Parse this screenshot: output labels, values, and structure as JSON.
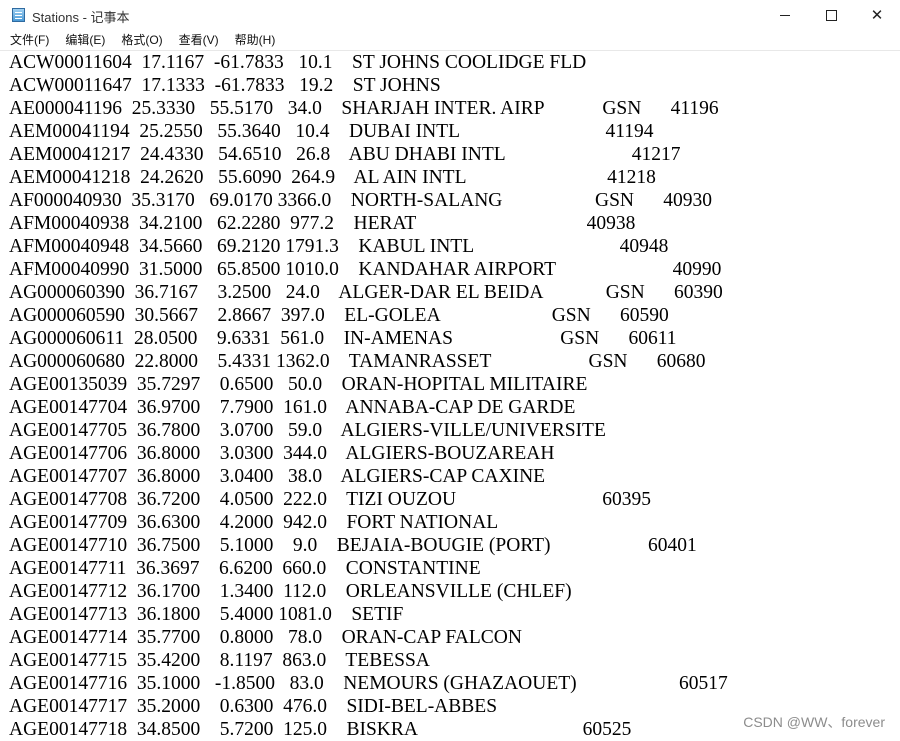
{
  "window": {
    "title": "Stations - 记事本",
    "icon": "notepad-icon"
  },
  "menu": [
    "文件(F)",
    "编辑(E)",
    "格式(O)",
    "查看(V)",
    "帮助(H)"
  ],
  "lines": [
    "ACW00011604  17.1167  -61.7833   10.1    ST JOHNS COOLIDGE FLD",
    "ACW00011647  17.1333  -61.7833   19.2    ST JOHNS",
    "AE000041196  25.3330   55.5170   34.0    SHARJAH INTER. AIRP            GSN      41196",
    "AEM00041194  25.2550   55.3640   10.4    DUBAI INTL                              41194",
    "AEM00041217  24.4330   54.6510   26.8    ABU DHABI INTL                          41217",
    "AEM00041218  24.2620   55.6090  264.9    AL AIN INTL                             41218",
    "AF000040930  35.3170   69.0170 3366.0    NORTH-SALANG                   GSN      40930",
    "AFM00040938  34.2100   62.2280  977.2    HERAT                                   40938",
    "AFM00040948  34.5660   69.2120 1791.3    KABUL INTL                              40948",
    "AFM00040990  31.5000   65.8500 1010.0    KANDAHAR AIRPORT                        40990",
    "AG000060390  36.7167    3.2500   24.0    ALGER-DAR EL BEIDA             GSN      60390",
    "AG000060590  30.5667    2.8667  397.0    EL-GOLEA                       GSN      60590",
    "AG000060611  28.0500    9.6331  561.0    IN-AMENAS                      GSN      60611",
    "AG000060680  22.8000    5.4331 1362.0    TAMANRASSET                    GSN      60680",
    "AGE00135039  35.7297    0.6500   50.0    ORAN-HOPITAL MILITAIRE",
    "AGE00147704  36.9700    7.7900  161.0    ANNABA-CAP DE GARDE",
    "AGE00147705  36.7800    3.0700   59.0    ALGIERS-VILLE/UNIVERSITE",
    "AGE00147706  36.8000    3.0300  344.0    ALGIERS-BOUZAREAH",
    "AGE00147707  36.8000    3.0400   38.0    ALGIERS-CAP CAXINE",
    "AGE00147708  36.7200    4.0500  222.0    TIZI OUZOU                              60395",
    "AGE00147709  36.6300    4.2000  942.0    FORT NATIONAL",
    "AGE00147710  36.7500    5.1000    9.0    BEJAIA-BOUGIE (PORT)                    60401",
    "AGE00147711  36.3697    6.6200  660.0    CONSTANTINE",
    "AGE00147712  36.1700    1.3400  112.0    ORLEANSVILLE (CHLEF)",
    "AGE00147713  36.1800    5.4000 1081.0    SETIF",
    "AGE00147714  35.7700    0.8000   78.0    ORAN-CAP FALCON",
    "AGE00147715  35.4200    8.1197  863.0    TEBESSA",
    "AGE00147716  35.1000   -1.8500   83.0    NEMOURS (GHAZAOUET)                     60517",
    "AGE00147717  35.2000    0.6300  476.0    SIDI-BEL-ABBES",
    "AGE00147718  34.8500    5.7200  125.0    BISKRA                                  60525"
  ],
  "watermark": "CSDN @WW、forever"
}
